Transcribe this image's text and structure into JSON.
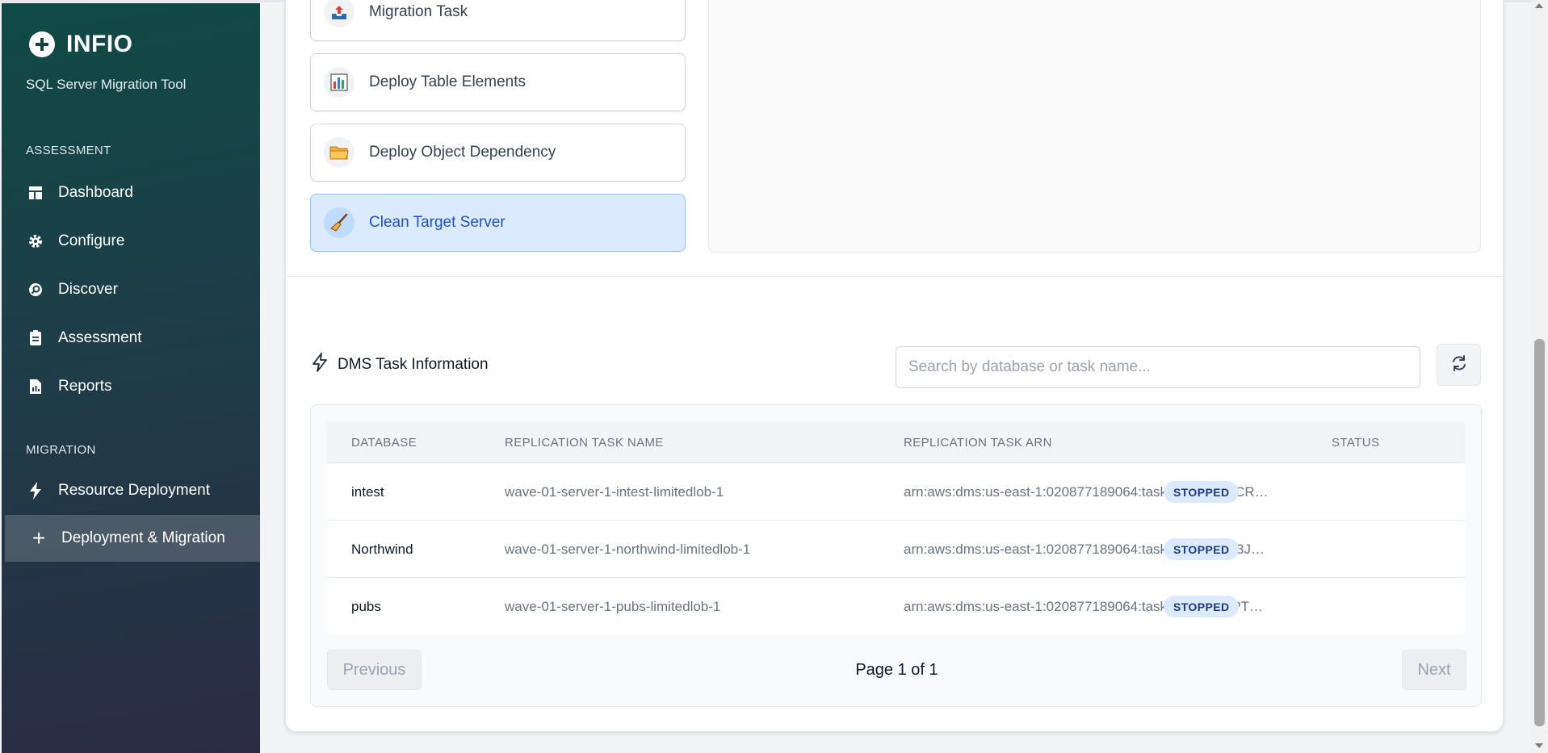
{
  "brand": {
    "name": "INFIO",
    "subtitle": "SQL Server Migration Tool"
  },
  "sidebar": {
    "sections": [
      {
        "label": "ASSESSMENT",
        "items": [
          {
            "label": "Dashboard",
            "icon": "dashboard-icon"
          },
          {
            "label": "Configure",
            "icon": "gear-icon"
          },
          {
            "label": "Discover",
            "icon": "discover-icon"
          },
          {
            "label": "Assessment",
            "icon": "clipboard-icon"
          },
          {
            "label": "Reports",
            "icon": "report-icon"
          }
        ]
      },
      {
        "label": "MIGRATION",
        "items": [
          {
            "label": "Resource Deployment",
            "icon": "lightning-icon"
          },
          {
            "label": "Deployment & Migration",
            "icon": "plus-icon",
            "active": true
          }
        ]
      }
    ]
  },
  "tasks": [
    {
      "label": "Migration Task",
      "icon": "upload-tray-icon"
    },
    {
      "label": "Deploy Table Elements",
      "icon": "bar-chart-icon"
    },
    {
      "label": "Deploy Object Dependency",
      "icon": "folder-icon"
    },
    {
      "label": "Clean Target Server",
      "icon": "broom-icon",
      "active": true
    }
  ],
  "dms": {
    "title": "DMS Task Information",
    "search_placeholder": "Search by database or task name...",
    "columns": [
      "DATABASE",
      "REPLICATION TASK NAME",
      "REPLICATION TASK ARN",
      "STATUS"
    ],
    "rows": [
      {
        "database": "intest",
        "task_name": "wave-01-server-1-intest-limitedlob-1",
        "arn": "arn:aws:dms:us-east-1:020877189064:task:FR7TIKV4CR…",
        "status": "STOPPED"
      },
      {
        "database": "Northwind",
        "task_name": "wave-01-server-1-northwind-limitedlob-1",
        "arn": "arn:aws:dms:us-east-1:020877189064:task:FH3YEIET3J…",
        "status": "STOPPED"
      },
      {
        "database": "pubs",
        "task_name": "wave-01-server-1-pubs-limitedlob-1",
        "arn": "arn:aws:dms:us-east-1:020877189064:task:K7TFJPMPT…",
        "status": "STOPPED"
      }
    ],
    "pagination": {
      "previous": "Previous",
      "page_info": "Page 1 of 1",
      "next": "Next"
    }
  },
  "colors": {
    "accent": "#1d4ed8",
    "sidebar_start": "#0f4a46",
    "sidebar_end": "#2b2c44",
    "status_badge": "#dbeafe"
  }
}
